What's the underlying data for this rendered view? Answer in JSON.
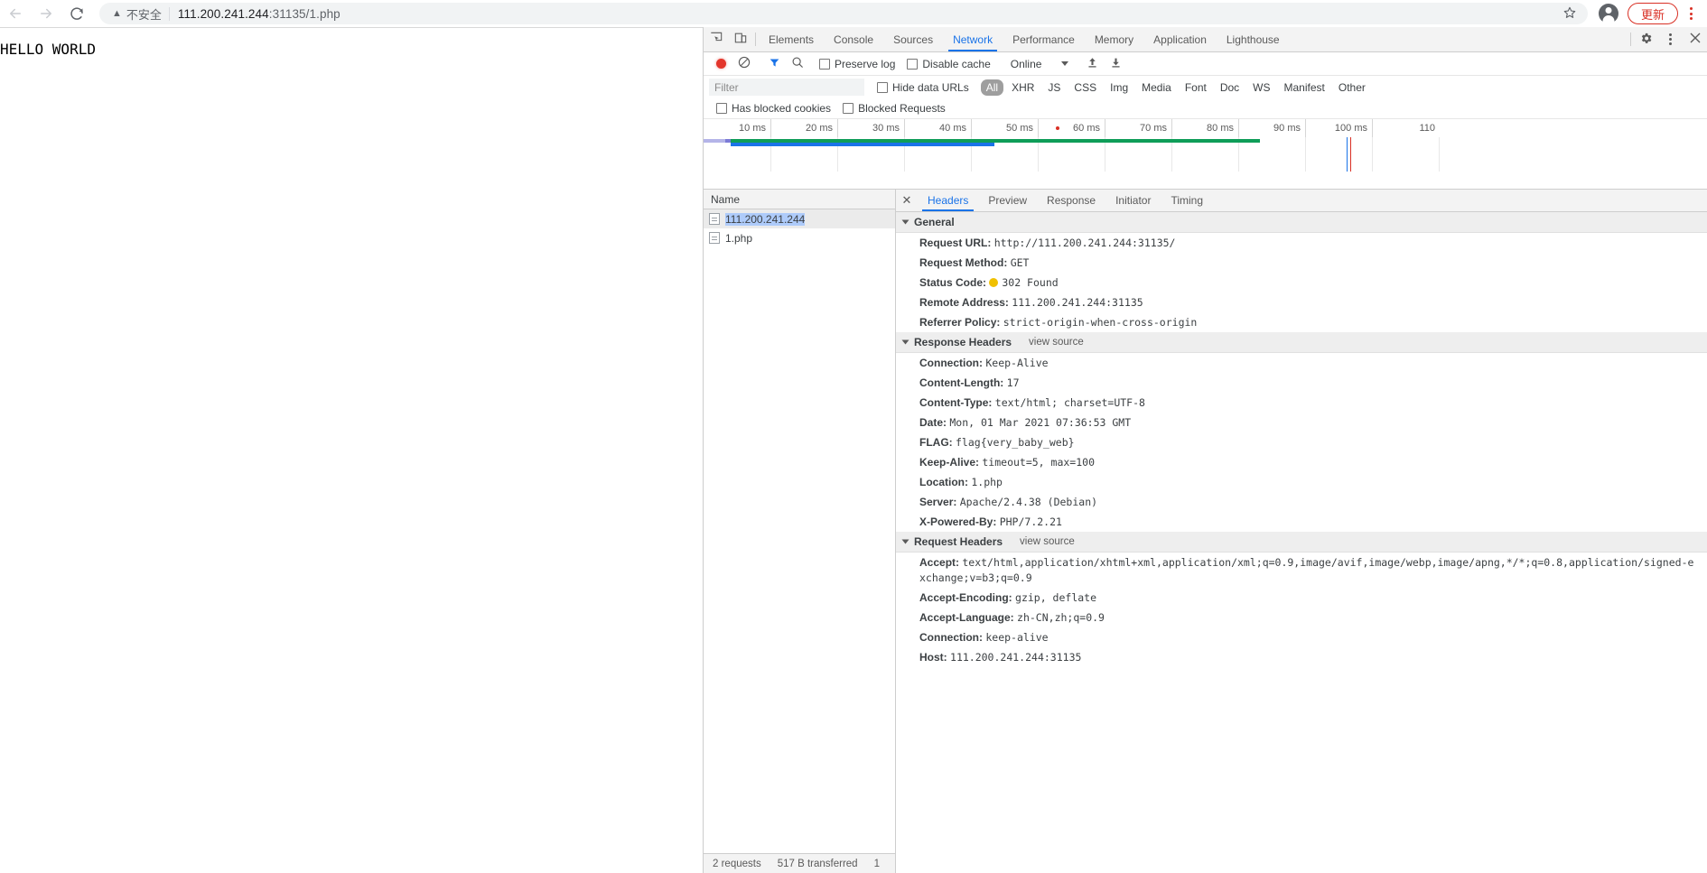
{
  "browser": {
    "back_icon": "back-arrow-icon",
    "forward_icon": "forward-arrow-icon",
    "reload_icon": "reload-icon",
    "security_label": "不安全",
    "url_host": "111.200.241.244",
    "url_rest": ":31135/1.php",
    "star_icon": "bookmark-star-icon",
    "profile_icon": "profile-avatar-icon",
    "update_label": "更新",
    "menu_icon": "chrome-menu-icon"
  },
  "page": {
    "body_text": "HELLO WORLD"
  },
  "devtools": {
    "inspect_icon": "inspect-element-icon",
    "device_icon": "device-toolbar-icon",
    "tabs": [
      {
        "label": "Elements",
        "active": false
      },
      {
        "label": "Console",
        "active": false
      },
      {
        "label": "Sources",
        "active": false
      },
      {
        "label": "Network",
        "active": true
      },
      {
        "label": "Performance",
        "active": false
      },
      {
        "label": "Memory",
        "active": false
      },
      {
        "label": "Application",
        "active": false
      },
      {
        "label": "Lighthouse",
        "active": false
      }
    ],
    "settings_icon": "gear-icon",
    "more_icon": "kebab-menu-icon",
    "close_icon": "close-icon",
    "network_toolbar": {
      "record_icon": "record-button-icon",
      "clear_icon": "clear-icon",
      "filter_icon": "filter-funnel-icon",
      "search_icon": "search-icon",
      "preserve_log": "Preserve log",
      "disable_cache": "Disable cache",
      "throttle_value": "Online",
      "import_icon": "import-har-icon",
      "export_icon": "export-har-icon"
    },
    "filter_row": {
      "placeholder": "Filter",
      "value": "",
      "hide_data_urls": "Hide data URLs",
      "types": [
        "All",
        "XHR",
        "JS",
        "CSS",
        "Img",
        "Media",
        "Font",
        "Doc",
        "WS",
        "Manifest",
        "Other"
      ],
      "selected_type": "All"
    },
    "blocked_row": {
      "has_blocked_cookies": "Has blocked cookies",
      "blocked_requests": "Blocked Requests"
    },
    "overview": {
      "ticks": [
        "10 ms",
        "20 ms",
        "30 ms",
        "40 ms",
        "50 ms",
        "60 ms",
        "70 ms",
        "80 ms",
        "90 ms",
        "100 ms",
        "110"
      ]
    },
    "requests": {
      "column_header": "Name",
      "rows": [
        {
          "name": "111.200.241.244",
          "selected": true
        },
        {
          "name": "1.php",
          "selected": false
        }
      ],
      "footer": {
        "requests": "2 requests",
        "transferred": "517 B transferred",
        "resources": "1"
      }
    },
    "detail": {
      "tabs": [
        {
          "label": "Headers",
          "active": true
        },
        {
          "label": "Preview",
          "active": false
        },
        {
          "label": "Response",
          "active": false
        },
        {
          "label": "Initiator",
          "active": false
        },
        {
          "label": "Timing",
          "active": false
        }
      ],
      "sections": [
        {
          "title": "General",
          "view_source": "",
          "items": [
            {
              "key": "Request URL:",
              "value": "http://111.200.241.244:31135/"
            },
            {
              "key": "Request Method:",
              "value": "GET"
            },
            {
              "key": "Status Code:",
              "value": "302 Found",
              "status_dot": "#f0c000"
            },
            {
              "key": "Remote Address:",
              "value": "111.200.241.244:31135"
            },
            {
              "key": "Referrer Policy:",
              "value": "strict-origin-when-cross-origin"
            }
          ]
        },
        {
          "title": "Response Headers",
          "view_source": "view source",
          "items": [
            {
              "key": "Connection:",
              "value": "Keep-Alive"
            },
            {
              "key": "Content-Length:",
              "value": "17"
            },
            {
              "key": "Content-Type:",
              "value": "text/html; charset=UTF-8"
            },
            {
              "key": "Date:",
              "value": "Mon, 01 Mar 2021 07:36:53 GMT"
            },
            {
              "key": "FLAG:",
              "value": "flag{very_baby_web}"
            },
            {
              "key": "Keep-Alive:",
              "value": "timeout=5, max=100"
            },
            {
              "key": "Location:",
              "value": "1.php"
            },
            {
              "key": "Server:",
              "value": "Apache/2.4.38 (Debian)"
            },
            {
              "key": "X-Powered-By:",
              "value": "PHP/7.2.21"
            }
          ]
        },
        {
          "title": "Request Headers",
          "view_source": "view source",
          "items": [
            {
              "key": "Accept:",
              "value": "text/html,application/xhtml+xml,application/xml;q=0.9,image/avif,image/webp,image/apng,*/*;q=0.8,application/signed-exchange;v=b3;q=0.9"
            },
            {
              "key": "Accept-Encoding:",
              "value": "gzip, deflate"
            },
            {
              "key": "Accept-Language:",
              "value": "zh-CN,zh;q=0.9"
            },
            {
              "key": "Connection:",
              "value": "keep-alive"
            },
            {
              "key": "Host:",
              "value": "111.200.241.244:31135"
            }
          ]
        }
      ]
    }
  }
}
